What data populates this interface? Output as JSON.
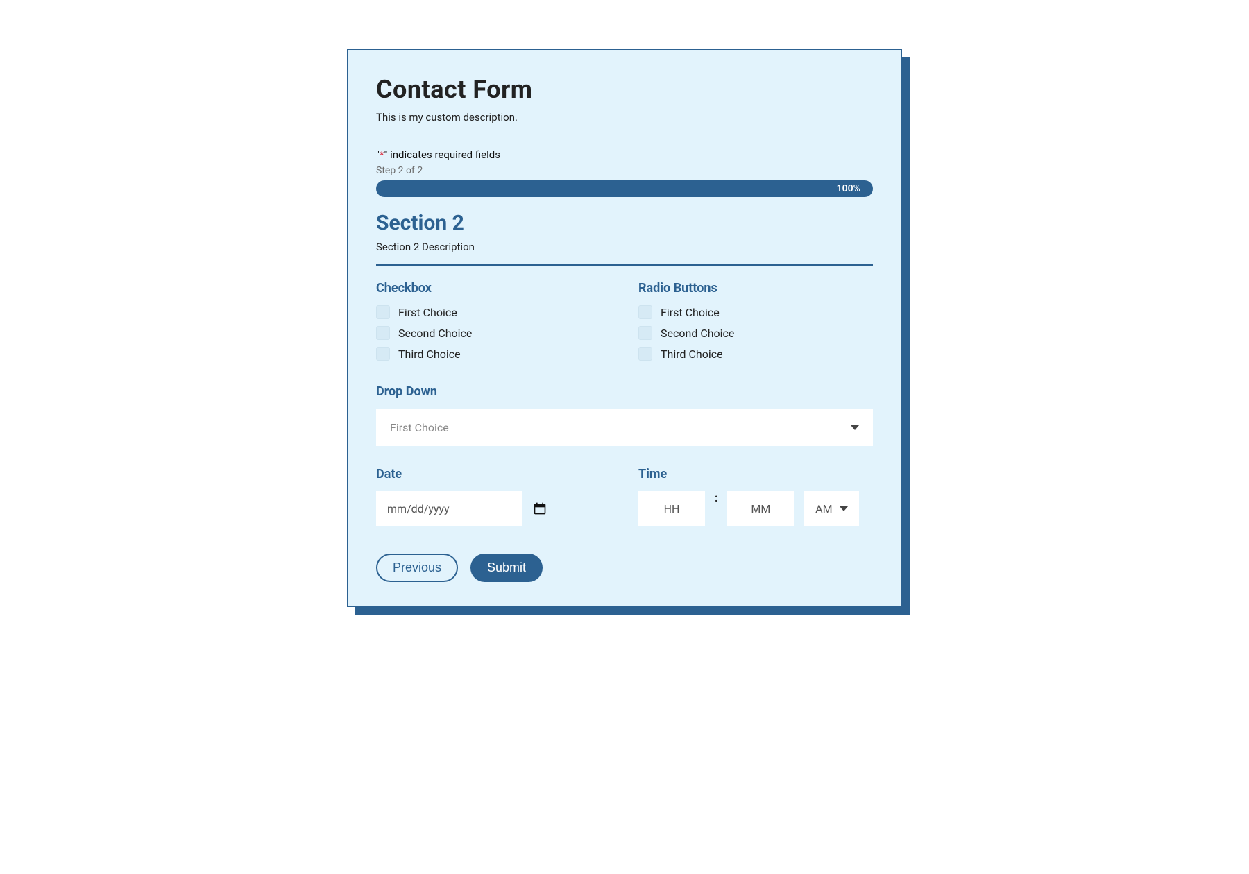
{
  "form": {
    "title": "Contact Form",
    "description": "This is my custom description.",
    "required_note_prefix": "\"",
    "required_note_star": "*",
    "required_note_suffix": "\" indicates required fields",
    "step_label": "Step 2 of 2",
    "progress_pct": "100%"
  },
  "section": {
    "title": "Section 2",
    "description": "Section 2 Description"
  },
  "checkbox_field": {
    "label": "Checkbox",
    "options": [
      "First Choice",
      "Second Choice",
      "Third Choice"
    ]
  },
  "radio_field": {
    "label": "Radio Buttons",
    "options": [
      "First Choice",
      "Second Choice",
      "Third Choice"
    ]
  },
  "dropdown_field": {
    "label": "Drop Down",
    "selected": "First Choice"
  },
  "date_field": {
    "label": "Date",
    "placeholder": "mm/dd/yyyy"
  },
  "time_field": {
    "label": "Time",
    "hh_placeholder": "HH",
    "mm_placeholder": "MM",
    "ampm": "AM",
    "separator": ":"
  },
  "buttons": {
    "previous": "Previous",
    "submit": "Submit"
  }
}
